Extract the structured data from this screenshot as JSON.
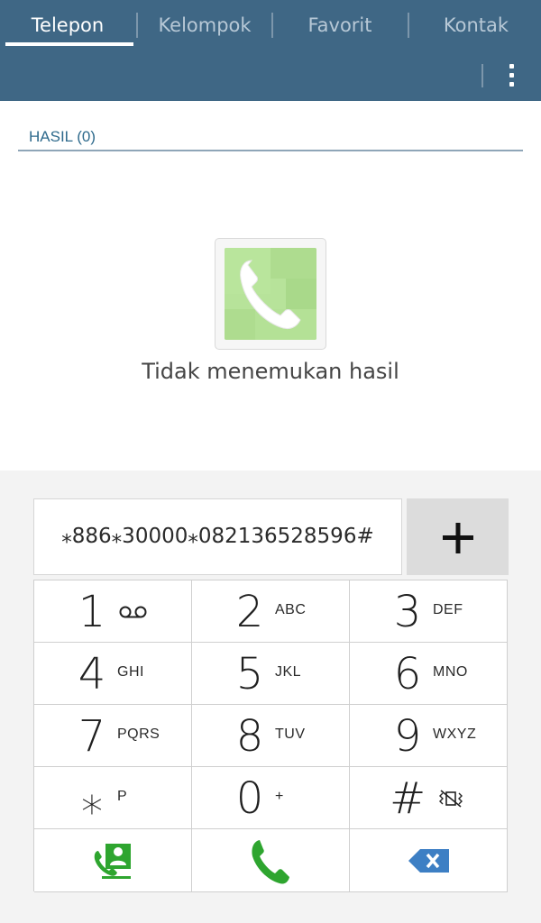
{
  "tabs": [
    {
      "label": "Telepon",
      "active": true
    },
    {
      "label": "Kelompok",
      "active": false
    },
    {
      "label": "Favorit",
      "active": false
    },
    {
      "label": "Kontak",
      "active": false
    }
  ],
  "toolbar": {
    "menu_icon": "more-vertical-icon"
  },
  "results": {
    "header": "HASIL (0)"
  },
  "empty_state": {
    "icon": "phone-handset-icon",
    "message": "Tidak menemukan hasil"
  },
  "dialer": {
    "number": "⁎886⁎30000⁎082136528596#",
    "add_icon": "plus-icon",
    "keys": [
      {
        "digit": "1",
        "letters": "",
        "sub_icon": "voicemail-icon"
      },
      {
        "digit": "2",
        "letters": "ABC"
      },
      {
        "digit": "3",
        "letters": "DEF"
      },
      {
        "digit": "4",
        "letters": "GHI"
      },
      {
        "digit": "5",
        "letters": "JKL"
      },
      {
        "digit": "6",
        "letters": "MNO"
      },
      {
        "digit": "7",
        "letters": "PQRS"
      },
      {
        "digit": "8",
        "letters": "TUV"
      },
      {
        "digit": "9",
        "letters": "WXYZ"
      },
      {
        "digit": "⁎",
        "letters": "P"
      },
      {
        "digit": "0",
        "letters": "+"
      },
      {
        "digit": "#",
        "letters": "",
        "sub_icon": "vibrate-mute-icon"
      }
    ],
    "bottom_row": [
      {
        "icon": "contacts-icon",
        "color": "#2ea52f"
      },
      {
        "icon": "call-icon",
        "color": "#2ea52f"
      },
      {
        "icon": "backspace-icon",
        "color": "#3d7fc4"
      }
    ]
  },
  "colors": {
    "header_bg": "#3f6785",
    "accent": "#2e6a8c",
    "call_green": "#2ea52f",
    "delete_blue": "#3d7fc4"
  }
}
